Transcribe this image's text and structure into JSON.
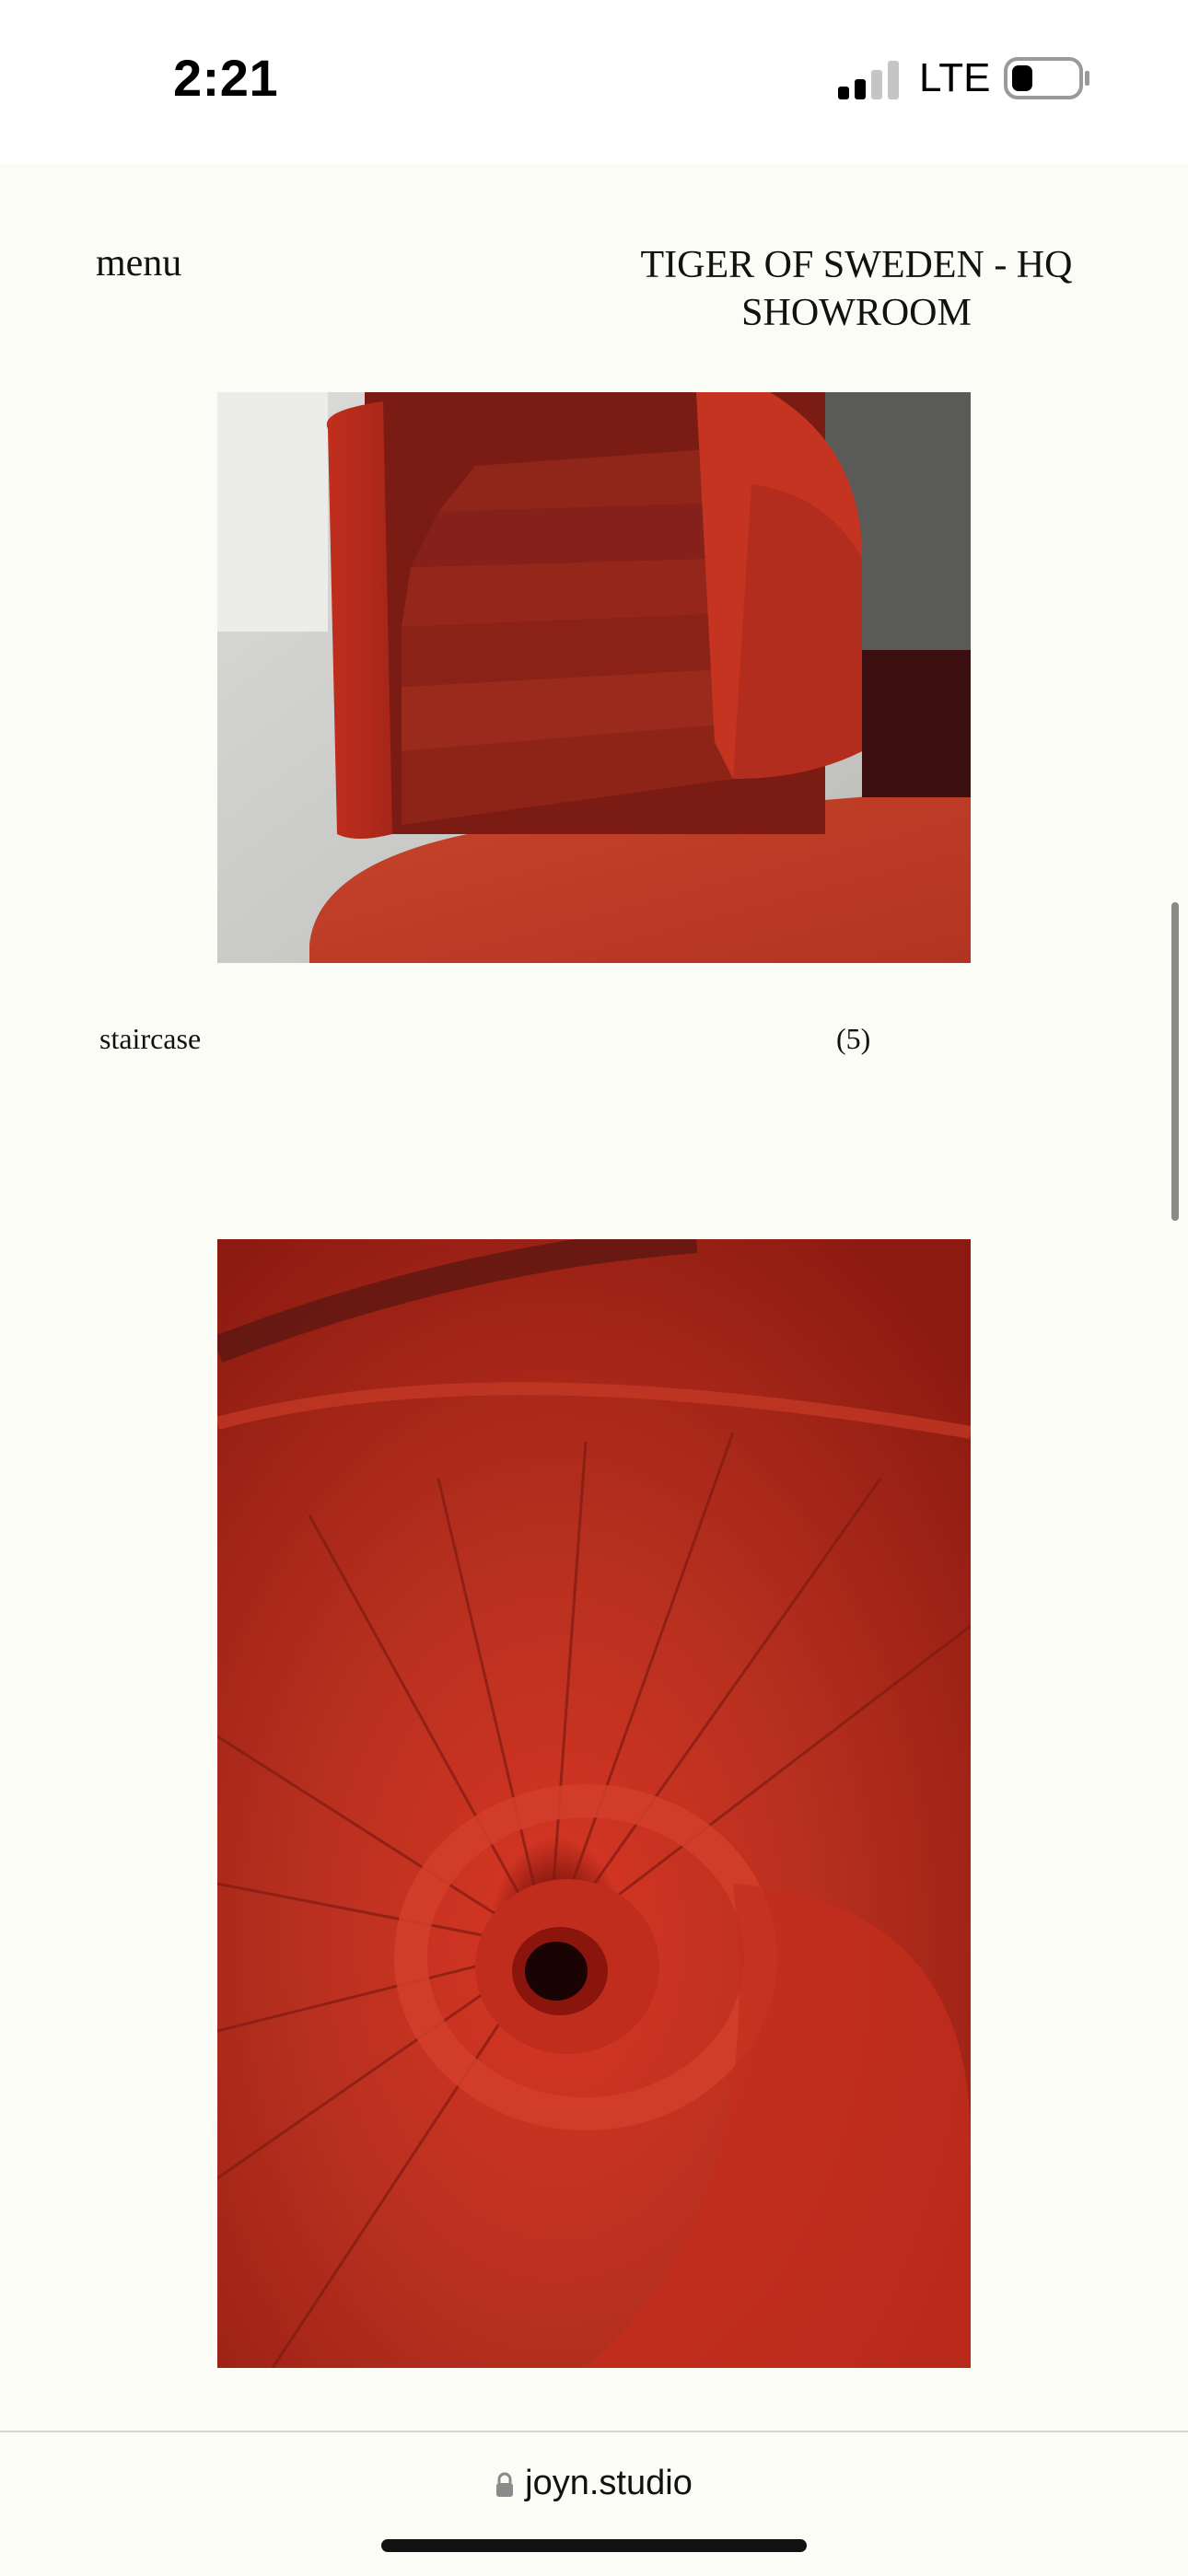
{
  "status_bar": {
    "time": "2:21",
    "network": "LTE",
    "icons": [
      "signal-icon",
      "battery-icon"
    ]
  },
  "header": {
    "menu_label": "menu",
    "title": "TIGER OF SWEDEN - HQ SHOWROOM"
  },
  "gallery": {
    "items": [
      {
        "caption": "staircase",
        "count": "(5)",
        "image": "red carpeted curved staircase"
      },
      {
        "caption": "",
        "count": "",
        "image": "red spiral staircase viewed from above"
      }
    ]
  },
  "browser": {
    "url": "joyn.studio",
    "icons": [
      "lock-icon"
    ]
  },
  "colors": {
    "background": "#fcfcf6",
    "accent_red": "#c8321e"
  }
}
